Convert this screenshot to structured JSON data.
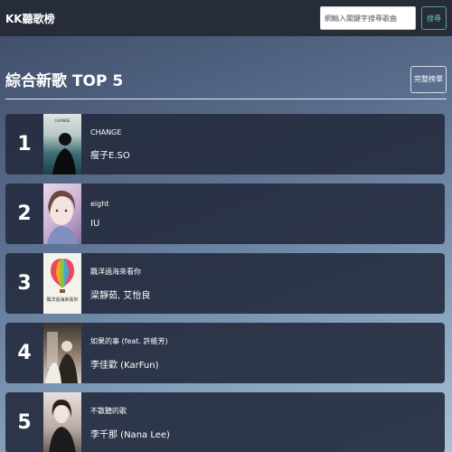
{
  "app": {
    "brand": "KK聽歌榜"
  },
  "search": {
    "placeholder": "網輸入關鍵字搜尋歌曲",
    "button_label": "搜尋"
  },
  "header": {
    "title": "綜合新歌 TOP 5",
    "full_list_label": "完整榜單"
  },
  "chart": [
    {
      "rank": "1",
      "song": "CHANGE",
      "artist": "瘦子E.SO",
      "cover_text": "CHANGE"
    },
    {
      "rank": "2",
      "song": "eight",
      "artist": "IU",
      "cover_text": ""
    },
    {
      "rank": "3",
      "song": "飄洋過海來看你",
      "artist": "梁靜茹, 艾怡良",
      "cover_text": "飄洋過海來看你"
    },
    {
      "rank": "4",
      "song": "如果的事 (feat. 許維芳)",
      "artist": "李佳歡 (KarFun)",
      "cover_text": ""
    },
    {
      "rank": "5",
      "song": "不散聽的歌",
      "artist": "李千那 (Nana Lee)",
      "cover_text": ""
    }
  ],
  "colors": {
    "topbar": "#262c38",
    "row": "#262c40",
    "accent": "#64c2c6"
  }
}
